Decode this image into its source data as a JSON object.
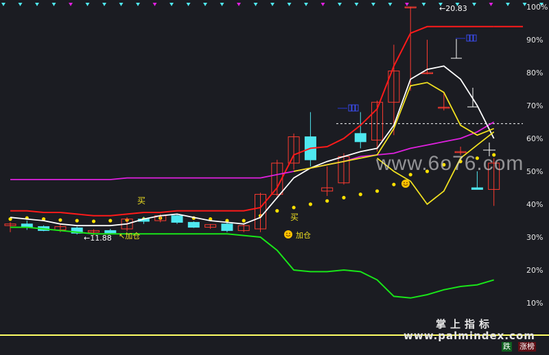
{
  "chart_data": {
    "type": "candlestick",
    "title": "",
    "ylabel": "",
    "y_axis_ticks": [
      "100%",
      "90%",
      "80%",
      "70%",
      "60%",
      "50%",
      "40%",
      "30%",
      "20%",
      "10%"
    ],
    "ylim": [
      0,
      100
    ],
    "grid": false,
    "colors": {
      "up_candle": "#ff3b30",
      "down_candle": "#4fe8f0",
      "upper_band": "#ff1a1a",
      "lower_band": "#19e619",
      "middle_line": "#e020e0",
      "fast_line": "#ffffff",
      "slow_line": "#f0e020",
      "dots": "#ffe000",
      "base_line": "#ffff66"
    },
    "candles": [
      {
        "o": 33.5,
        "h": 34.5,
        "l": 31.5,
        "c": 34.0
      },
      {
        "o": 34.0,
        "h": 35.0,
        "l": 32.2,
        "c": 33.0
      },
      {
        "o": 33.2,
        "h": 33.6,
        "l": 31.8,
        "c": 32.0
      },
      {
        "o": 32.2,
        "h": 33.8,
        "l": 31.5,
        "c": 33.2
      },
      {
        "o": 32.8,
        "h": 33.2,
        "l": 30.8,
        "c": 31.2
      },
      {
        "o": 31.5,
        "h": 32.4,
        "l": 30.5,
        "c": 32.0
      },
      {
        "o": 32.0,
        "h": 32.5,
        "l": 30.8,
        "c": 31.3
      },
      {
        "o": 32.5,
        "h": 36.0,
        "l": 31.8,
        "c": 35.5
      },
      {
        "o": 35.5,
        "h": 36.2,
        "l": 34.0,
        "c": 34.8
      },
      {
        "o": 35.0,
        "h": 37.0,
        "l": 34.5,
        "c": 36.5
      },
      {
        "o": 36.5,
        "h": 37.0,
        "l": 34.0,
        "c": 34.5
      },
      {
        "o": 34.5,
        "h": 34.8,
        "l": 32.8,
        "c": 33.0
      },
      {
        "o": 33.0,
        "h": 34.0,
        "l": 32.5,
        "c": 33.8
      },
      {
        "o": 34.0,
        "h": 34.5,
        "l": 31.5,
        "c": 32.0
      },
      {
        "o": 32.0,
        "h": 34.0,
        "l": 31.5,
        "c": 33.5
      },
      {
        "o": 32.5,
        "h": 43.5,
        "l": 31.5,
        "c": 43.0
      },
      {
        "o": 43.0,
        "h": 53.5,
        "l": 42.5,
        "c": 52.5
      },
      {
        "o": 52.5,
        "h": 61.5,
        "l": 50.5,
        "c": 60.5
      },
      {
        "o": 60.5,
        "h": 68.0,
        "l": 51.5,
        "c": 53.5
      },
      {
        "o": 44.0,
        "h": 51.5,
        "l": 42.5,
        "c": 45.0
      },
      {
        "o": 46.5,
        "h": 55.5,
        "l": 46.0,
        "c": 54.5
      },
      {
        "o": 61.5,
        "h": 68.0,
        "l": 57.0,
        "c": 59.0
      },
      {
        "o": 59.5,
        "h": 71.5,
        "l": 56.0,
        "c": 71.0
      },
      {
        "o": 71.0,
        "h": 88.5,
        "l": 61.0,
        "c": 80.5
      },
      {
        "o": 100.0,
        "h": 100.0,
        "l": 74.5,
        "c": 100.0
      },
      {
        "o": 80.0,
        "h": 90.0,
        "l": 79.5,
        "c": 80.0
      },
      {
        "o": 69.5,
        "h": 74.0,
        "l": 68.5,
        "c": 69.5
      },
      {
        "o": 56.0,
        "h": 57.5,
        "l": 55.0,
        "c": 56.0
      },
      {
        "o": 45.0,
        "h": 50.0,
        "l": 44.5,
        "c": 44.5
      },
      {
        "o": 44.5,
        "h": 54.0,
        "l": 39.5,
        "c": 52.5
      }
    ],
    "series": [
      {
        "values": [
          38,
          38,
          37.5,
          37.5,
          37,
          36.5,
          36.5,
          37,
          37.5,
          37.5,
          38,
          38,
          38,
          38,
          38,
          39,
          45,
          55,
          57,
          57.5,
          60,
          64,
          69,
          82,
          92,
          94,
          94,
          94,
          94,
          94
        ]
      },
      {
        "values": [
          33,
          33,
          32.5,
          32,
          31.5,
          31,
          31,
          31,
          31,
          31,
          31,
          31,
          31,
          31,
          30.5,
          30,
          26,
          20,
          19.5,
          19.5,
          20,
          19.5,
          17,
          12,
          11.5,
          12.5,
          14,
          15,
          15.5,
          17
        ]
      },
      {
        "values": [
          47.5,
          47.5,
          47.5,
          47.5,
          47.5,
          47.5,
          47.5,
          48,
          48,
          48,
          48,
          48,
          48,
          48,
          48,
          48,
          49,
          50,
          51,
          52,
          53,
          54.5,
          55,
          55.5,
          57,
          58,
          59,
          60,
          62,
          65
        ]
      },
      {
        "values": [
          36,
          35.5,
          35,
          34,
          33.5,
          33.5,
          33.5,
          34,
          35.5,
          36.5,
          37,
          36,
          35,
          34.5,
          34,
          36,
          42,
          48,
          51,
          53,
          54.5,
          56,
          57,
          64,
          78,
          81,
          82,
          78,
          70,
          60
        ]
      },
      {
        "values": [
          null,
          null,
          null,
          null,
          null,
          null,
          null,
          null,
          null,
          null,
          null,
          null,
          null,
          null,
          null,
          null,
          null,
          50,
          51,
          52,
          53,
          54,
          55,
          63,
          76,
          77,
          74,
          64,
          61,
          63
        ]
      },
      {
        "values": [
          null,
          null,
          null,
          null,
          null,
          null,
          null,
          null,
          null,
          null,
          null,
          null,
          null,
          null,
          null,
          null,
          null,
          null,
          null,
          null,
          null,
          null,
          54,
          50,
          47,
          40,
          44,
          54,
          58,
          62
        ]
      }
    ],
    "dots": [
      35.5,
      35.8,
      35.5,
      35.2,
      35,
      34.8,
      35,
      35.2,
      35.5,
      35.8,
      36,
      35.8,
      35.5,
      35,
      35,
      36.5,
      38,
      39,
      40,
      41,
      42,
      43,
      44,
      46,
      49,
      50,
      52,
      53,
      54,
      55
    ],
    "dashed_level": 64.5,
    "annotations": {
      "low_price": "11.88",
      "high_price": "20.83",
      "buy_1": "买",
      "buy_2": "买",
      "add_1": "加仓",
      "add_2": "加仓"
    },
    "watermarks": {
      "site1": "www.6o76.com",
      "brand": "掌上指标",
      "site2": "www.palmindex.com"
    },
    "buttons": {
      "fall": "跌",
      "rise": "涨榜"
    }
  }
}
